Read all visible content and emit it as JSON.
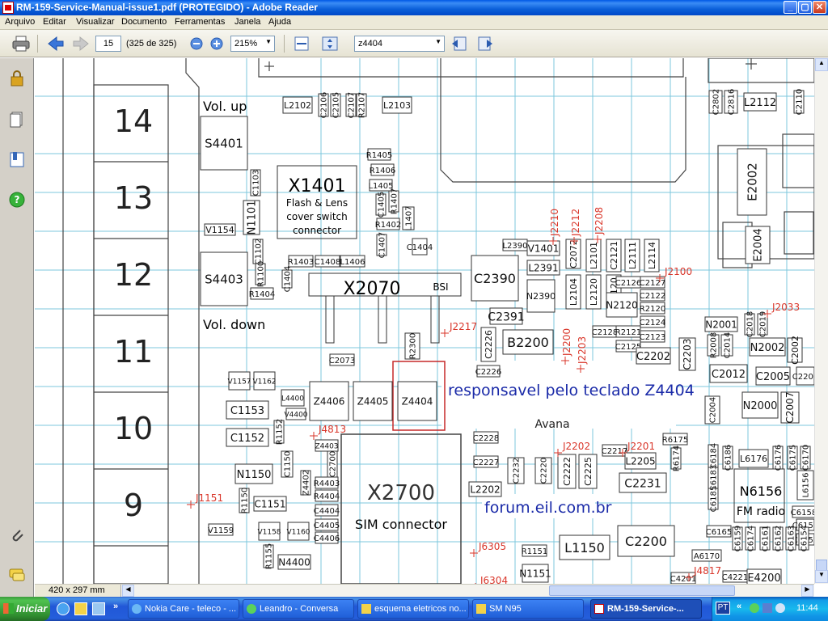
{
  "window": {
    "title": "RM-159-Service-Manual-issue1.pdf (PROTEGIDO) - Adobe Reader"
  },
  "menu": [
    "Arquivo",
    "Editar",
    "Visualizar",
    "Documento",
    "Ferramentas",
    "Janela",
    "Ajuda"
  ],
  "toolbar": {
    "page_value": "15",
    "page_count": "(325 de 325)",
    "zoom_value": "215%",
    "search_value": "z4404"
  },
  "status": {
    "page_size": "420 x 297 mm"
  },
  "schematic": {
    "row_numbers": [
      "14",
      "13",
      "12",
      "11",
      "10",
      "9"
    ],
    "labels": {
      "vol_up": "Vol. up",
      "vol_down": "Vol. down",
      "x1401": "X1401",
      "flash_lens": [
        "Flash & Lens",
        "cover switch",
        "connector"
      ],
      "x2070": "X2070",
      "bsi": "BSI",
      "x2700": "X2700",
      "sim": "SIM connector",
      "n6156": "N6156",
      "fm_radio": "FM radio",
      "annotation": "responsavel pelo teclado Z4404",
      "forum": "forum.eil.com.br",
      "avana": "Avana"
    },
    "components": [
      "S4401",
      "S4403",
      "L2102",
      "C2106",
      "C2105",
      "C2107",
      "R2107",
      "L2103",
      "C1103",
      "N1101",
      "V1154",
      "C1102",
      "R1100",
      "R1405",
      "R1406",
      "L1405",
      "C1405",
      "R1407",
      "R1402",
      "L1407",
      "C1407",
      "R1403",
      "C1408",
      "L1406",
      "R1404",
      "C1404",
      "C1404b",
      "V1401",
      "L2391",
      "C2390",
      "L2390",
      "C2072",
      "L2104",
      "L2101",
      "L2120",
      "C2121",
      "C2120",
      "L2111",
      "L2114",
      "C2126",
      "C2127",
      "C2122",
      "R2120",
      "N2120",
      "N2390",
      "C2391",
      "B2200",
      "C2124",
      "C2128",
      "R2121",
      "C2123",
      "C2125",
      "C2226",
      "C2226b",
      "C2202",
      "C2203",
      "N2001",
      "C2018",
      "C2019",
      "R2008",
      "C2014",
      "N2002",
      "C2002",
      "C2012",
      "C2005",
      "C2200",
      "N2000",
      "C2007",
      "C2004",
      "E2002",
      "E2004",
      "C2802",
      "C2816",
      "L2112",
      "C2110",
      "R2300",
      "C2073",
      "V1157",
      "V1162",
      "C1153",
      "C1152",
      "L4400",
      "V4400",
      "R1152",
      "Z4406",
      "Z4405",
      "Z4404",
      "C2228",
      "C2227",
      "C2232",
      "C2220",
      "C2222",
      "C2225",
      "C2217",
      "L2205",
      "C2231",
      "R6175",
      "R6174",
      "C6184",
      "C6183",
      "C6185",
      "C6186",
      "L6176",
      "C6176",
      "C6175",
      "C6170",
      "L6156",
      "C6158",
      "C6157",
      "C6155",
      "C6165",
      "C6159",
      "C6174",
      "C6161",
      "C6162",
      "C6163",
      "C6154",
      "L2202",
      "N1150",
      "C1150",
      "Z4403",
      "C2700",
      "Z4402",
      "R4403",
      "R4404",
      "C4404",
      "C4405",
      "C4406",
      "C1151",
      "R1150",
      "V1158",
      "V1160",
      "V1159",
      "R1155",
      "N4400",
      "R1151",
      "L1150",
      "N1151",
      "C2200b",
      "A6170",
      "C4221",
      "E4200",
      "C4201"
    ],
    "ref_points": [
      "J2210",
      "J2212",
      "J2208",
      "J2100",
      "J2217",
      "J2200",
      "J2203",
      "J2033",
      "J4813",
      "J1151",
      "J2202",
      "J2201",
      "J6305",
      "J6304",
      "J4817"
    ]
  },
  "taskbar": {
    "start": "Iniciar",
    "tasks": [
      "Nokia Care - teleco - ...",
      "Leandro - Conversa",
      "esquema eletricos no...",
      "SM N95",
      "RM-159-Service-..."
    ],
    "lang": "PT",
    "clock": "11:44"
  },
  "colors": {
    "title_blue": "#0a5fd8",
    "grid": "#7cc7dc",
    "annotation": "#1a2aa8",
    "highlight": "#c62828",
    "red_ref": "#d9362a"
  }
}
